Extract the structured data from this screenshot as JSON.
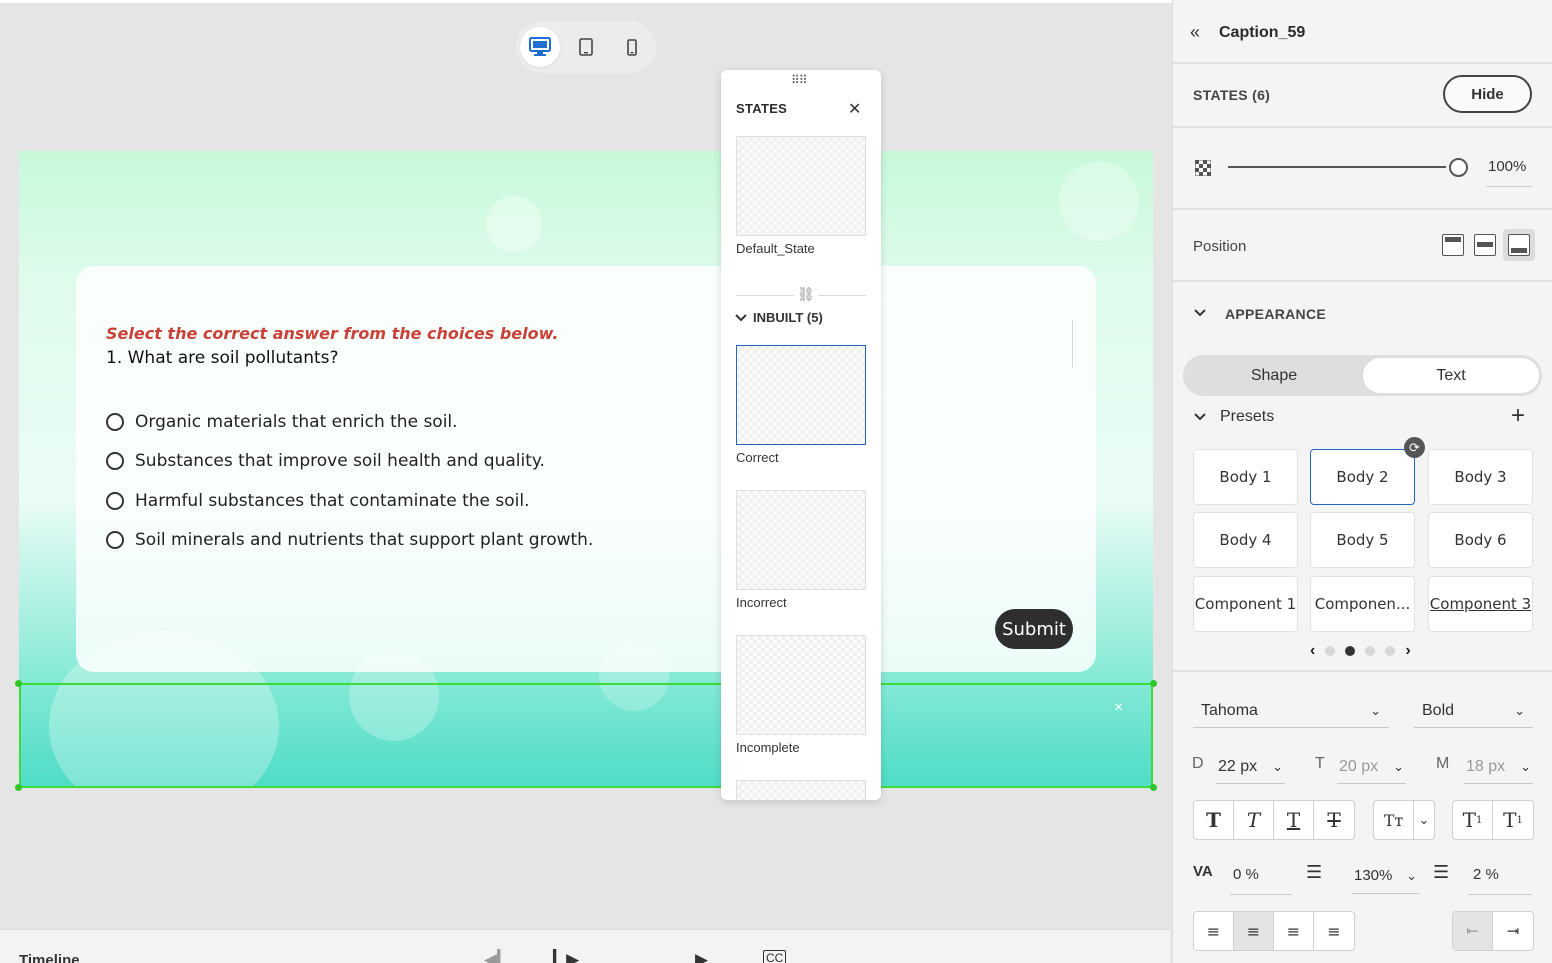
{
  "stage": {
    "devices": [
      "desktop-icon",
      "tablet-icon",
      "phone-icon"
    ],
    "question": {
      "instruction": "Select the correct answer from the choices below.",
      "text": "1. What are soil pollutants?",
      "options": [
        "Organic materials that enrich the soil.",
        "Substances that improve soil health and quality.",
        "Harmful substances that contaminate the soil.",
        "Soil minerals and nutrients that support plant growth."
      ],
      "submit_label": "Submit"
    },
    "caption_close": "×"
  },
  "states_panel": {
    "title": "STATES",
    "close": "✕",
    "default_state": "Default_State",
    "inbuilt_label": "INBUILT (5)",
    "states": [
      "Correct",
      "Incorrect",
      "Incomplete"
    ]
  },
  "timeline": {
    "label": "Timeline"
  },
  "right_panel": {
    "title": "Caption_59",
    "states_label": "STATES (6)",
    "hide_label": "Hide",
    "opacity": "100%",
    "position_label": "Position",
    "appearance_label": "APPEARANCE",
    "tabs": {
      "shape": "Shape",
      "text": "Text"
    },
    "presets_label": "Presets",
    "presets": [
      "Body 1",
      "Body 2",
      "Body 3",
      "Body 4",
      "Body 5",
      "Body 6",
      "Component 1",
      "Componen...",
      "Component 3"
    ],
    "selected_preset": "Body 2",
    "font_family": "Tahoma",
    "font_weight": "Bold",
    "size_d_letter": "D",
    "size_d": "22 px",
    "size_t_letter": "T",
    "size_t": "20 px",
    "size_m_letter": "M",
    "size_m": "18 px",
    "letter_spacing": "0 %",
    "line_height": "130%",
    "paragraph_spacing": "2 %"
  }
}
